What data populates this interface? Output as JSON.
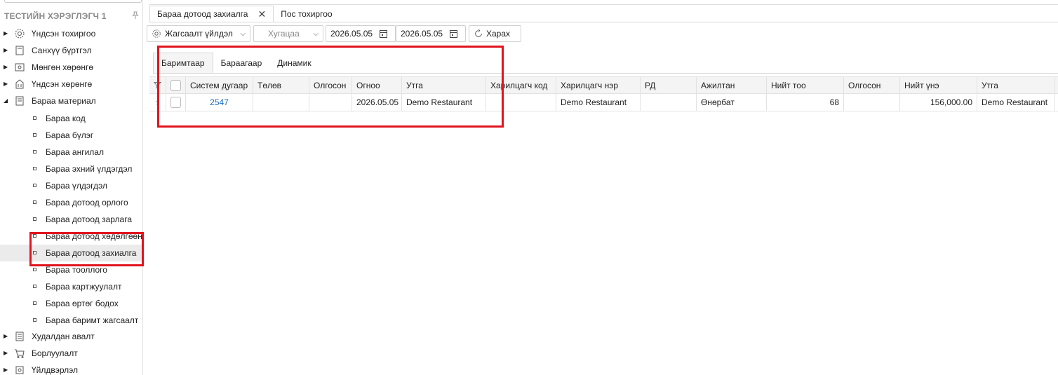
{
  "sidebar": {
    "title": "ТЕСТИЙН ХЭРЭГЛЭГЧ 1",
    "top_items": [
      {
        "label": "Үндсэн тохиргоо",
        "icon": "gear-icon"
      },
      {
        "label": "Санхүү бүртгэл",
        "icon": "ledger-icon"
      },
      {
        "label": "Мөнгөн хөрөнгө",
        "icon": "money-icon"
      },
      {
        "label": "Үндсэн хөрөнгө",
        "icon": "building-icon"
      },
      {
        "label": "Бараа материал",
        "icon": "document-icon"
      }
    ],
    "sub_items": [
      "Бараа код",
      "Бараа бүлэг",
      "Бараа ангилал",
      "Бараа эхний үлдэгдэл",
      "Бараа үлдэгдэл",
      "Бараа дотоод орлого",
      "Бараа дотоод зарлага",
      "Бараа дотоод хөдөлгөөн",
      "Бараа дотоод захиалга",
      "Бараа тооллого",
      "Бараа картжуулалт",
      "Бараа өртөг бодох",
      "Бараа баримт жагсаалт"
    ],
    "bottom_items": [
      {
        "label": "Худалдан авалт",
        "icon": "list-icon"
      },
      {
        "label": "Борлуулалт",
        "icon": "cart-icon"
      },
      {
        "label": "Үйлдвэрлэл",
        "icon": "factory-icon"
      }
    ]
  },
  "doc_tabs": [
    {
      "label": "Бараа дотоод захиалга"
    },
    {
      "label": "Пос тохиргоо"
    }
  ],
  "toolbar": {
    "list_action": "Жагсаалт үйлдэл",
    "period_placeholder": "Хугацаа",
    "date_from": "2026.05.05",
    "date_to": "2026.05.05",
    "view_button": "Харах"
  },
  "sub_tabs": [
    "Баримтаар",
    "Бараагаар",
    "Динамик"
  ],
  "grid": {
    "columns": [
      "Систем дугаар",
      "Төлөв",
      "Олгосон",
      "Огноо",
      "Утга",
      "Харилцагч код",
      "Харилцагч нэр",
      "РД",
      "Ажилтан",
      "Нийт тоо",
      "Олгосон",
      "Нийт үнэ",
      "Утга"
    ],
    "rows": [
      [
        "2547",
        "",
        "",
        "2026.05.05",
        "Demo Restaurant",
        "",
        "Demo Restaurant",
        "",
        "Өнөрбат",
        "68",
        "",
        "156,000.00",
        "Demo Restaurant"
      ]
    ]
  },
  "colors": {
    "highlight": "#e0141e",
    "link": "#1a6fc2"
  }
}
